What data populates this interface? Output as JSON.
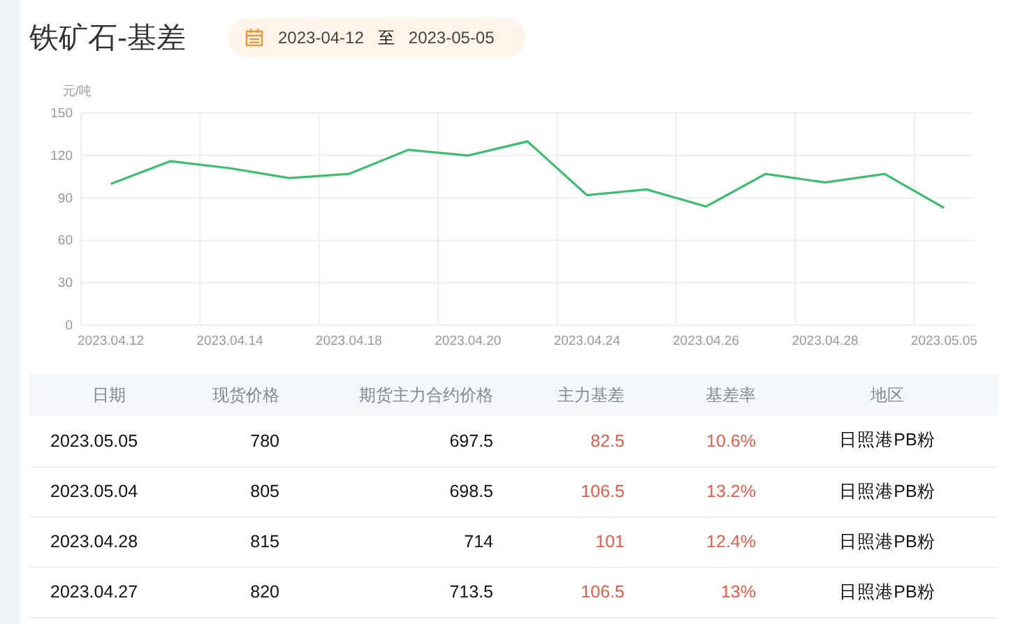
{
  "title": "铁矿石-基差",
  "date_range": {
    "start": "2023-04-12",
    "separator": "至",
    "end": "2023-05-05"
  },
  "chart_data": {
    "type": "line",
    "ylabel": "元/吨",
    "categories": [
      "2023.04.12",
      null,
      "2023.04.14",
      null,
      "2023.04.18",
      null,
      "2023.04.20",
      null,
      "2023.04.24",
      null,
      "2023.04.26",
      null,
      "2023.04.28",
      null,
      "2023.05.05"
    ],
    "grid": true,
    "ylim": [
      0,
      150
    ],
    "yticks": [
      0,
      30,
      60,
      90,
      120,
      150
    ],
    "series": [
      {
        "color": "#3dbd6e",
        "values": [
          100,
          116,
          111,
          104,
          107,
          124,
          120,
          130,
          92,
          96,
          84,
          107,
          101,
          107,
          83
        ]
      }
    ]
  },
  "table": {
    "columns": [
      "日期",
      "现货价格",
      "期货主力合约价格",
      "主力基差",
      "基差率",
      "地区"
    ],
    "rows": [
      [
        "2023.05.05",
        "780",
        "697.5",
        "82.5",
        "10.6%",
        "日照港PB粉"
      ],
      [
        "2023.05.04",
        "805",
        "698.5",
        "106.5",
        "13.2%",
        "日照港PB粉"
      ],
      [
        "2023.04.28",
        "815",
        "714",
        "101",
        "12.4%",
        "日照港PB粉"
      ],
      [
        "2023.04.27",
        "820",
        "713.5",
        "106.5",
        "13%",
        "日照港PB粉"
      ]
    ]
  }
}
